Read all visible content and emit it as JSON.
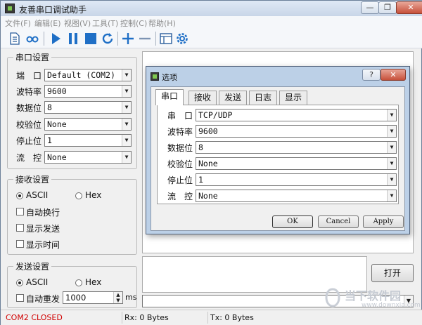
{
  "window": {
    "title": "友善串口调试助手",
    "minimize": "—",
    "maximize": "❐",
    "close": "✕"
  },
  "menu": [
    "文件(F)",
    "编辑(E)",
    "视图(V)",
    "工具(T)",
    "控制(C)",
    "帮助(H)"
  ],
  "toolbar_icons": [
    "document-icon",
    "loop-icon",
    "play-icon",
    "pause-icon",
    "stop-icon",
    "refresh-icon",
    "plus-icon",
    "minus-icon",
    "window-icon",
    "gear-icon"
  ],
  "port_settings": {
    "legend": "串口设置",
    "fields": [
      {
        "label": "端　口",
        "value": "Default (COM2)"
      },
      {
        "label": "波特率",
        "value": "9600"
      },
      {
        "label": "数据位",
        "value": "8"
      },
      {
        "label": "校验位",
        "value": "None"
      },
      {
        "label": "停止位",
        "value": "1"
      },
      {
        "label": "流　控",
        "value": "None"
      }
    ]
  },
  "receive_settings": {
    "legend": "接收设置",
    "ascii": "ASCII",
    "hex": "Hex",
    "auto_wrap": "自动换行",
    "show_send": "显示发送",
    "show_time": "显示时间"
  },
  "send_settings": {
    "legend": "发送设置",
    "ascii": "ASCII",
    "hex": "Hex",
    "auto_resend": "自动重发",
    "interval": "1000",
    "unit": "ms"
  },
  "open_button": "打开",
  "status": {
    "port": "COM2 CLOSED",
    "rx": "Rx: 0 Bytes",
    "tx": "Tx: 0 Bytes"
  },
  "dialog": {
    "title": "选项",
    "help": "?",
    "close": "✕",
    "tabs": [
      "串口",
      "接收",
      "发送",
      "日志",
      "显示"
    ],
    "fields": [
      {
        "label": "串　口",
        "value": "TCP/UDP"
      },
      {
        "label": "波特率",
        "value": "9600"
      },
      {
        "label": "数据位",
        "value": "8"
      },
      {
        "label": "校验位",
        "value": "None"
      },
      {
        "label": "停止位",
        "value": "1"
      },
      {
        "label": "流　控",
        "value": "None"
      }
    ],
    "ok": "OK",
    "cancel": "Cancel",
    "apply": "Apply"
  },
  "watermark": {
    "brand": "当下软件园",
    "url": "www.downxia.com"
  },
  "colors": {
    "status_port": "#d10000",
    "toolbar_blue": "#1f6fc6"
  }
}
